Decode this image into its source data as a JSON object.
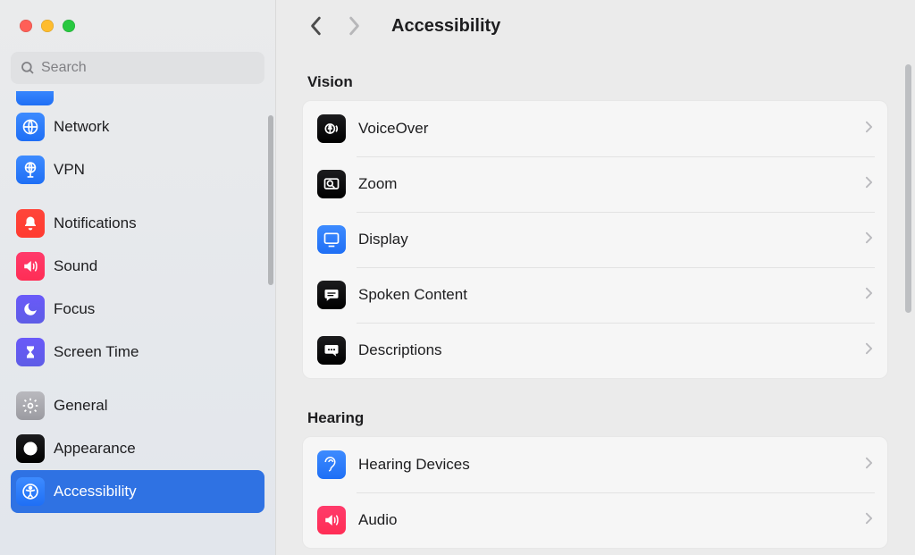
{
  "search": {
    "placeholder": "Search"
  },
  "sidebar": {
    "items": [
      {
        "label": "Network"
      },
      {
        "label": "VPN"
      },
      {
        "label": "Notifications"
      },
      {
        "label": "Sound"
      },
      {
        "label": "Focus"
      },
      {
        "label": "Screen Time"
      },
      {
        "label": "General"
      },
      {
        "label": "Appearance"
      },
      {
        "label": "Accessibility"
      }
    ]
  },
  "page": {
    "title": "Accessibility"
  },
  "sections": {
    "vision": {
      "title": "Vision",
      "rows": [
        {
          "label": "VoiceOver"
        },
        {
          "label": "Zoom"
        },
        {
          "label": "Display"
        },
        {
          "label": "Spoken Content"
        },
        {
          "label": "Descriptions"
        }
      ]
    },
    "hearing": {
      "title": "Hearing",
      "rows": [
        {
          "label": "Hearing Devices"
        },
        {
          "label": "Audio"
        }
      ]
    }
  }
}
